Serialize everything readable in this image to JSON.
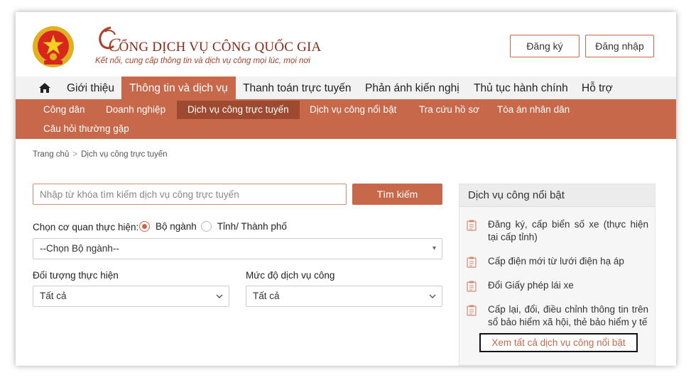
{
  "brand": {
    "title_initial": "C",
    "title_rest": "ỔNG DỊCH VỤ CÔNG QUỐC GIA",
    "tagline": "Kết nối, cung cấp thông tin và dịch vụ công mọi lúc, mọi nơi"
  },
  "auth": {
    "register": "Đăng ký",
    "login": "Đăng nhập"
  },
  "main_nav": [
    {
      "label": "Giới thiệu"
    },
    {
      "label": "Thông tin và dịch vụ"
    },
    {
      "label": "Thanh toán trực tuyến"
    },
    {
      "label": "Phản ánh kiến nghị"
    },
    {
      "label": "Thủ tục hành chính"
    },
    {
      "label": "Hỗ trợ"
    }
  ],
  "sub_nav": [
    {
      "label": "Công dân"
    },
    {
      "label": "Doanh nghiệp"
    },
    {
      "label": "Dịch vụ công trực tuyến"
    },
    {
      "label": "Dịch vụ công nổi bật"
    },
    {
      "label": "Tra cứu hồ sơ"
    },
    {
      "label": "Tòa án nhân dân"
    },
    {
      "label": "Câu hỏi thường gặp"
    }
  ],
  "breadcrumb": {
    "home": "Trang chủ",
    "sep": ">",
    "current": "Dịch vụ công trực tuyến"
  },
  "search": {
    "placeholder": "Nhập từ khóa tìm kiếm dịch vụ công trực tuyến",
    "button": "Tìm kiếm"
  },
  "filters": {
    "agency_label": "Chọn cơ quan thực hiện:",
    "radio_ministry": "Bộ ngành",
    "radio_province": "Tỉnh/ Thành phố",
    "ministry_select": "--Chọn Bộ ngành--",
    "target_label": "Đối tượng thực hiện",
    "target_value": "Tất cả",
    "level_label": "Mức độ dịch vụ công",
    "level_value": "Tất cả"
  },
  "featured": {
    "title": "Dịch vụ công nổi bật",
    "items": [
      "Đăng ký, cấp biển số xe (thực hiện tại cấp tỉnh)",
      "Cấp điện mới từ lưới điện hạ áp",
      "Đổi Giấy phép lái xe",
      "Cấp lại, đổi, điều chỉnh thông tin trên sổ bảo hiểm xã hội, thẻ bảo hiểm y tế"
    ],
    "see_all": "Xem tất cả dịch vụ công nổi bật"
  },
  "colors": {
    "accent": "#c8684a",
    "accent_dark": "#9e4a31",
    "brand_text": "#8a2a1a"
  }
}
